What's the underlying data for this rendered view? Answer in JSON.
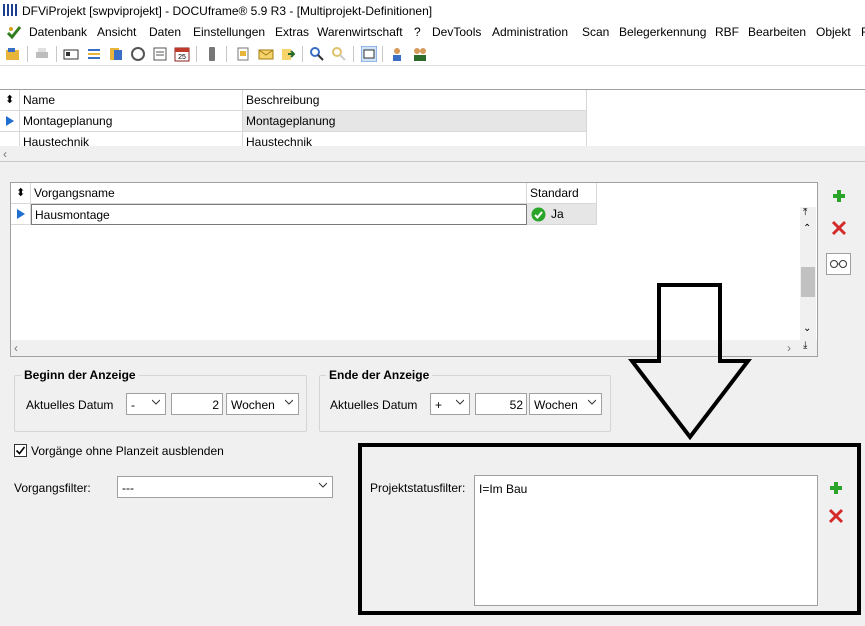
{
  "window": {
    "title": "DFViProjekt [swpviprojekt] - DOCUframe® 5.9 R3 - [Multiprojekt-Definitionen]"
  },
  "menu": {
    "items": [
      "Datenbank",
      "Ansicht",
      "Daten",
      "Einstellungen",
      "Extras",
      "Warenwirtschaft",
      "?",
      "DevTools",
      "Administration",
      "Scan",
      "Belegerkennung",
      "RBF",
      "Bearbeiten",
      "Objekt",
      "F"
    ]
  },
  "toolbar": {
    "calendar_day": "25"
  },
  "project_grid": {
    "columns": [
      "Name",
      "Beschreibung"
    ],
    "rows": [
      {
        "name": "Montageplanung",
        "description": "Montageplanung"
      },
      {
        "name": "Haustechnik",
        "description": "Haustechnik"
      }
    ]
  },
  "operations_grid": {
    "columns": [
      "Vorgangsname",
      "Standard"
    ],
    "rows": [
      {
        "name": "Hausmontage",
        "standard": "Ja"
      }
    ]
  },
  "display_start": {
    "title": "Beginn der Anzeige",
    "label": "Aktuelles Datum",
    "sign": "-",
    "value": "2",
    "unit": "Wochen"
  },
  "display_end": {
    "title": "Ende der Anzeige",
    "label": "Aktuelles Datum",
    "sign": "+",
    "value": "52",
    "unit": "Wochen"
  },
  "hide_unscheduled": {
    "label": "Vorgänge ohne Planzeit ausblenden",
    "checked": true
  },
  "operation_filter": {
    "label": "Vorgangsfilter:",
    "value": "---"
  },
  "project_status_filter": {
    "label": "Projektstatusfilter:",
    "value": "I=Im Bau"
  },
  "colors": {
    "accent_blue": "#1f6fd1",
    "add_green": "#2aa52a",
    "delete_red": "#d42a2a",
    "annotation_black": "#000000"
  }
}
